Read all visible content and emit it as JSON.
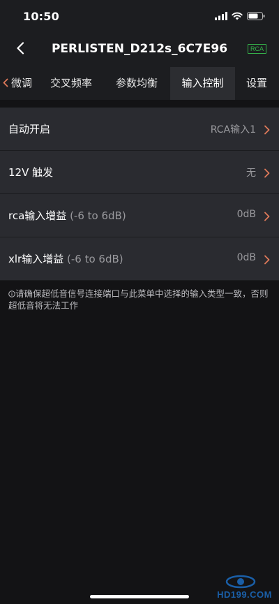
{
  "status_bar": {
    "time": "10:50",
    "icons": [
      "cellular-signal-icon",
      "wifi-icon",
      "battery-icon"
    ]
  },
  "nav": {
    "back_icon": "chevron-left-icon",
    "title": "PERLISTEN_D212s_6C7E96",
    "badge": "RCA"
  },
  "tabs": {
    "scroll_left_icon": "chevron-left-icon",
    "items": [
      {
        "label": "微调",
        "active": false
      },
      {
        "label": "交叉频率",
        "active": false
      },
      {
        "label": "参数均衡",
        "active": false
      },
      {
        "label": "输入控制",
        "active": true
      },
      {
        "label": "设置",
        "active": false
      }
    ]
  },
  "settings": [
    {
      "label": "自动开启",
      "range": "",
      "value": "RCA输入1"
    },
    {
      "label": "12V 触发",
      "range": "",
      "value": "无"
    },
    {
      "label": "rca输入增益",
      "range": "(-6 to 6dB)",
      "value": "0dB"
    },
    {
      "label": "xlr输入增益",
      "range": "(-6 to 6dB)",
      "value": "0dB"
    }
  ],
  "notice": {
    "icon": "info-icon",
    "text": "请确保超低音信号连接端口与此菜单中选择的输入类型一致，否则超低音将无法工作"
  },
  "watermark": {
    "text": "HD199.COM"
  },
  "colors": {
    "background": "#131315",
    "bar": "#1c1d20",
    "row": "#2a2b30",
    "active_tab": "#2c2d31",
    "accent_chevron": "#e07a5a",
    "badge_green": "#35b34a",
    "watermark_blue": "#1a5fa8"
  }
}
